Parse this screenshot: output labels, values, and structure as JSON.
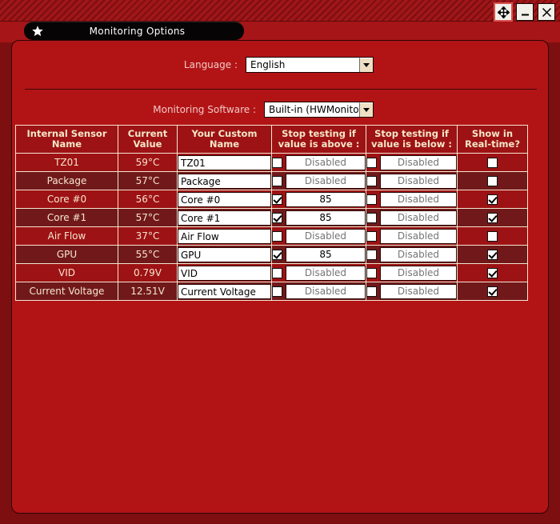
{
  "window": {
    "controls": [
      {
        "name": "move-button",
        "icon": "move-icon",
        "active": true
      },
      {
        "name": "minimize-button",
        "icon": "minimize-icon",
        "active": false
      },
      {
        "name": "close-button",
        "icon": "close-icon",
        "active": false
      }
    ]
  },
  "tab": {
    "icon": "star-icon",
    "label": "Monitoring Options"
  },
  "settings": {
    "language_label": "Language :",
    "language_value": "English",
    "software_label": "Monitoring Software :",
    "software_value": "Built-in (HWMonitor)",
    "dropdown_icon": "chevron-down-icon"
  },
  "table": {
    "headers": [
      "Internal Sensor Name",
      "Current Value",
      "Your Custom Name",
      "Stop testing if value is above :",
      "Stop testing if value is below :",
      "Show in Real-time?"
    ],
    "disabled_placeholder": "Disabled",
    "rows": [
      {
        "sensor": "TZ01",
        "value": "59°C",
        "custom": "TZ01",
        "above_checked": false,
        "above_value": "",
        "below_checked": false,
        "below_value": "",
        "realtime": false
      },
      {
        "sensor": "Package",
        "value": "57°C",
        "custom": "Package",
        "above_checked": false,
        "above_value": "",
        "below_checked": false,
        "below_value": "",
        "realtime": false
      },
      {
        "sensor": "Core #0",
        "value": "56°C",
        "custom": "Core #0",
        "above_checked": true,
        "above_value": "85",
        "below_checked": false,
        "below_value": "",
        "realtime": true
      },
      {
        "sensor": "Core #1",
        "value": "57°C",
        "custom": "Core #1",
        "above_checked": true,
        "above_value": "85",
        "below_checked": false,
        "below_value": "",
        "realtime": true
      },
      {
        "sensor": "Air Flow",
        "value": "37°C",
        "custom": "Air Flow",
        "above_checked": false,
        "above_value": "",
        "below_checked": false,
        "below_value": "",
        "realtime": false
      },
      {
        "sensor": "GPU",
        "value": "55°C",
        "custom": "GPU",
        "above_checked": true,
        "above_value": "85",
        "below_checked": false,
        "below_value": "",
        "realtime": true
      },
      {
        "sensor": "VID",
        "value": "0.79V",
        "custom": "VID",
        "above_checked": false,
        "above_value": "",
        "below_checked": false,
        "below_value": "",
        "realtime": true
      },
      {
        "sensor": "Current Voltage",
        "value": "12.51V",
        "custom": "Current Voltage",
        "above_checked": false,
        "above_value": "",
        "below_checked": false,
        "below_value": "",
        "realtime": true
      }
    ]
  },
  "colors": {
    "window_bg": "#7e0f10",
    "panel_bg": "#b21416",
    "titlebar": "#9e1214",
    "header_bg": "#9d1214",
    "row_odd": "#9d1214",
    "row_even": "#71191a",
    "grid_line": "#f4e6d0",
    "header_text": "#f5e7c8",
    "label_text": "#f0c9c4",
    "tab_bg": "#060404"
  }
}
